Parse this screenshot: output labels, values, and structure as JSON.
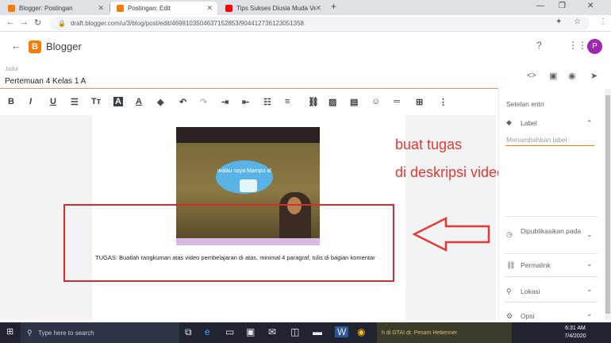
{
  "tabs": [
    {
      "label": "Blogger: Postingan",
      "favicon_color": "#f57c00"
    },
    {
      "label": "Postingan: Edit",
      "favicon_color": "#f57c00"
    },
    {
      "label": "Tips Sukses Diusia Muda Versi Al",
      "favicon_color": "#ff0000"
    }
  ],
  "address": {
    "url": "draft.blogger.com/u/3/blog/post/edit/4698103504637152853/9044127361230513​58"
  },
  "app": {
    "title": "Blogger",
    "logo_letter": "B",
    "avatar_letter": "P"
  },
  "post": {
    "title_label": "Judul",
    "title": "Pertemuan 4 Kelas 1 A"
  },
  "video": {
    "bubble_text": "walau saya Mampu al"
  },
  "content": {
    "tugas": "TUGAS: Buatlah rangkuman atas  video pembelajaran di atas, minimal 4 paragraf, tulis di bagian komentar"
  },
  "annotation": {
    "line1": "buat tugas",
    "line2": "di deskripsi video"
  },
  "settings": {
    "header": "Setelan entri",
    "label": "Label",
    "label_placeholder": "Menambahkan label",
    "published": "Dipublikasikan pada",
    "permalink": "Permalink",
    "location": "Lokasi",
    "options": "Opsi"
  },
  "taskbar": {
    "search_placeholder": "Type here to search",
    "time": "6:31 AM",
    "date": "7/4/2020",
    "news": "h di GTAI dr. Pesam Hebenner"
  }
}
